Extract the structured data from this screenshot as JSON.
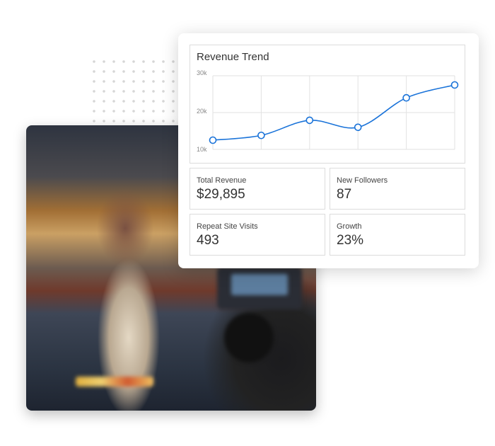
{
  "chart_data": {
    "type": "line",
    "title": "Revenue Trend",
    "x": [
      1,
      2,
      3,
      4,
      5,
      6
    ],
    "values": [
      12500,
      13800,
      17900,
      16000,
      24000,
      27500
    ],
    "yticks": [
      "10k",
      "20k",
      "30k"
    ],
    "ylim": [
      10000,
      30000
    ],
    "grid": true,
    "color": "#1a73d9"
  },
  "stats": [
    {
      "label": "Total Revenue",
      "value": "$29,895"
    },
    {
      "label": "New Followers",
      "value": "87"
    },
    {
      "label": "Repeat Site Visits",
      "value": "493"
    },
    {
      "label": "Growth",
      "value": "23%"
    }
  ]
}
